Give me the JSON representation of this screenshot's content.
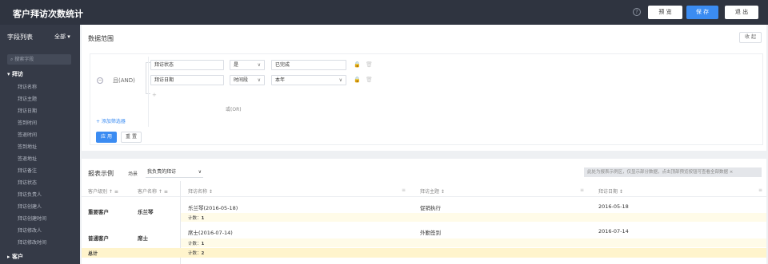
{
  "topbar": {
    "title": "客户拜访次数统计",
    "help_glyph": "?",
    "preview": "预 览",
    "save": "保 存",
    "exit": "退 出"
  },
  "sidebar": {
    "title": "字段列表",
    "filter": "全部",
    "search_placeholder": "搜索字段",
    "groups": [
      {
        "label": "拜访",
        "expanded": true
      },
      {
        "label": "客户",
        "expanded": false
      }
    ],
    "items": [
      "拜访名称",
      "拜访主题",
      "拜访日期",
      "签到时间",
      "签退时间",
      "签到地址",
      "签退地址",
      "拜访备注",
      "拜访状态",
      "拜访负责人",
      "拜访创建人",
      "拜访创建时间",
      "拜访修改人",
      "拜访修改时间"
    ]
  },
  "data_range": {
    "title": "数据范围",
    "collapse": "收 起",
    "and_label": "且(AND)",
    "or_label": "或(OR)",
    "conditions": [
      {
        "field": "拜访状态",
        "operator": "是",
        "value": "已完成"
      },
      {
        "field": "拜访日期",
        "operator": "时间段",
        "value": "本年"
      }
    ],
    "add_filter": "+ 添加筛选器",
    "apply": "应 用",
    "reset": "重 置"
  },
  "report": {
    "title": "报表示例",
    "scene_label": "场景",
    "scene_value": "我负责的拜访",
    "hint": "此处为报表示例区，仅显示部分数据，点击顶部预览按钮可查看全部数据 ×",
    "headers": [
      "客户级别",
      "客户名称",
      "拜访名称",
      "拜访主题",
      "拜访日期"
    ],
    "rows": [
      {
        "level": "重要客户",
        "customer": "乐兰琴",
        "name": "乐兰琴(2016-05-18)",
        "topic": "促销执行",
        "date": "2016-05-18",
        "count_label": "计数：",
        "count": "1"
      },
      {
        "level": "普通客户",
        "customer": "席士",
        "name": "席士(2016-07-14)",
        "topic": "外勤签到",
        "date": "2016-07-14",
        "count_label": "计数：",
        "count": "1"
      }
    ],
    "total_label": "总计",
    "total_count_label": "计数：",
    "total_count": "2"
  },
  "colors": {
    "topbar_bg": "#2f3440",
    "sidebar_bg": "#353a47",
    "accent": "#3b8cf2",
    "total_bg": "#fff4cc"
  }
}
